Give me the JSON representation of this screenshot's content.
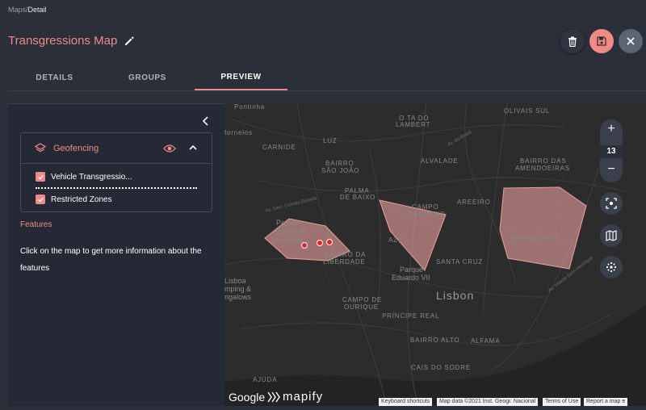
{
  "breadcrumb": {
    "parent": "Maps",
    "separator": "/",
    "current": "Detail"
  },
  "page": {
    "title": "Transgressions Map"
  },
  "header_buttons": {
    "delete_icon": "trash-icon",
    "save_icon": "save-icon",
    "close_icon": "close-icon"
  },
  "tabs": [
    {
      "label": "DETAILS",
      "active": false
    },
    {
      "label": "GROUPS",
      "active": false
    },
    {
      "label": "PREVIEW",
      "active": true
    }
  ],
  "panel": {
    "geofencing": {
      "title": "Geofencing",
      "layers": [
        {
          "label": "Vehicle Transgressio...",
          "checked": true
        },
        {
          "label": "Restricted Zones",
          "checked": true
        }
      ]
    },
    "features": {
      "title": "Features",
      "text": "Click on the map to get more information about the features"
    }
  },
  "map": {
    "zoom_in": "+",
    "zoom_level": "13",
    "zoom_out": "−",
    "labels": {
      "pontinha": "Pontinha",
      "olivais_sul": "OLIVAIS SUL",
      "o_ta_do": "O TA DO",
      "lambert": "LAMBERT",
      "fornelos": "fornelos",
      "carnide": "CARNIDE",
      "luz": "LUZ",
      "alvalade": "ALVALADE",
      "bairro_das": "BAIRRO DAS",
      "amendoeiras": "AMENDOEIRAS",
      "bairro": "BAIRRO",
      "sao_joao": "SÃO JOÃO",
      "palma": "PALMA",
      "de_baixo": "DE BAIXO",
      "campo": "CAMPO",
      "pequeno": "PEQUENO",
      "areeiro": "AREEIRO",
      "parque": "Parque",
      "florestal_de": "orestal de",
      "monsanto": "Monsanto",
      "bairro_da": "BAIRRO DA",
      "liberdade": "LIBERDADE",
      "azu": "AZU",
      "madre_deus": "MADRE DEUS",
      "santa_cruz": "SANTA CRUZ",
      "parque2": "Parque",
      "eduardo_vii": "Eduardo VII",
      "lisboa": "Lisboa",
      "mping": "mping &",
      "ngalows": "ngalows",
      "campo_de": "CAMPO DE",
      "ourique": "OURIQUE",
      "lisbon": "Lisbon",
      "principe_real": "PRÍNCIPE REAL",
      "bairro_alto": "BAIRRO ALTO",
      "alfama": "ALFAMA",
      "cais_do_sodre": "CAIS DO SODRE",
      "ajuda": "AJUDA",
      "av_do_brasil": "Av. do Brasil",
      "av_gen_correia": "Av. Gen. Correia Barreto",
      "av_infante": "Av. Infante Dom Henrique"
    },
    "branding": {
      "google": "Google",
      "mapify": "mapify"
    },
    "attribution": {
      "shortcuts": "Keyboard shortcuts",
      "data": "Map data ©2021 Inst. Geogr. Nacional",
      "terms": "Terms of Use",
      "report": "Report a map e"
    }
  },
  "colors": {
    "accent": "#ef8a86",
    "zone_fill": "#e8a09c",
    "marker": "#ff1a1a"
  }
}
